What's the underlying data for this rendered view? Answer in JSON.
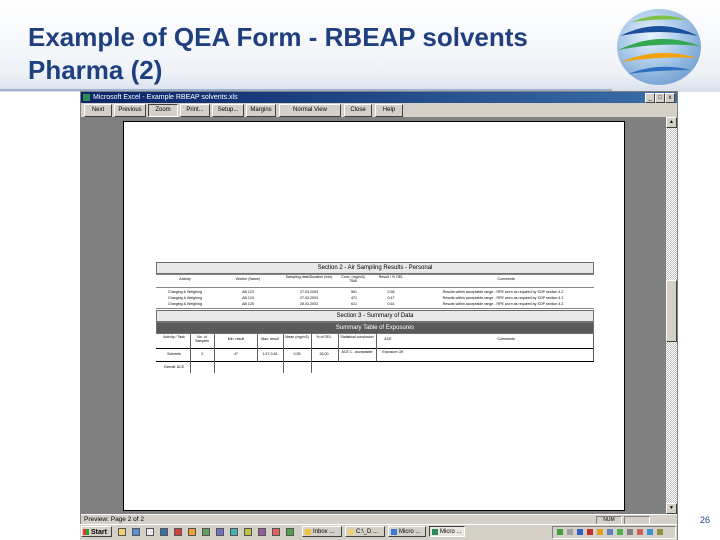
{
  "slide": {
    "title_line1": "Example of QEA Form - RBEAP solvents",
    "title_line2": "Pharma (2)",
    "page_number": "26"
  },
  "window": {
    "title": "Microsoft Excel - Example RBEAP solvents.xls",
    "minimize": "_",
    "restore": "□",
    "close": "x"
  },
  "toolbar": {
    "next": "Next",
    "previous": "Previous",
    "zoom": "Zoom",
    "print": "Print...",
    "setup": "Setup...",
    "margins": "Margins",
    "normal_view": "Normal View",
    "close": "Close",
    "help": "Help"
  },
  "sheet": {
    "section2_title": "Section 2 - Air Sampling Results - Personal",
    "section3_title": "Section 3 - Summary of Data",
    "section3_sub": "Summary Table of Exposures",
    "s2_headers": [
      "Activity",
      "Worker (Name)",
      "Sampling date/Duration (min)",
      "Conc. (mg/m3) TWA",
      "Result / % OEL",
      "Comments"
    ],
    "s2_rows": [
      [
        "Charging & Weighing",
        "AB 123",
        "27.03.2003",
        "56",
        "1",
        "0.56",
        "Results within acceptable range - RPE worn as required by SOP section 4.2"
      ],
      [
        "Charging & Weighing",
        "AB 124",
        "27.03.2003",
        "47",
        "1",
        "0.47",
        "Results within acceptable range - RPE worn as required by SOP section 4.2"
      ],
      [
        "Charging & Weighing",
        "AB 125",
        "28.03.2003",
        "61",
        "1",
        "0.61",
        "Results within acceptable range - RPE worn as required by SOP section 4.2"
      ]
    ],
    "s3_headers": [
      "Activity / Task",
      "No. of Samples",
      "Min. result",
      "Max. result",
      "Mean (mg/m3)",
      "% of OEL",
      "Statistical conclusion",
      "ACE",
      "Comments"
    ],
    "s3_rows": [
      [
        "Solvents",
        "3",
        "47",
        "1.47-0.61",
        "0.55",
        "28.00",
        "ACE 1 - acceptable",
        "Exposure OK"
      ]
    ],
    "s3_footer": "Overall: ACE"
  },
  "status": {
    "text": "Preview: Page 2 of 2",
    "num": "NUM"
  },
  "taskbar": {
    "start": "Start",
    "tasks": [
      "Inbox ...",
      "C:\\_D ...",
      "Micro ...",
      "Micro ..."
    ]
  },
  "colors": {
    "title": "#1f3f7f",
    "titlebar": "#0a246a",
    "chrome": "#d4d0c8",
    "preview_bg": "#808080"
  }
}
